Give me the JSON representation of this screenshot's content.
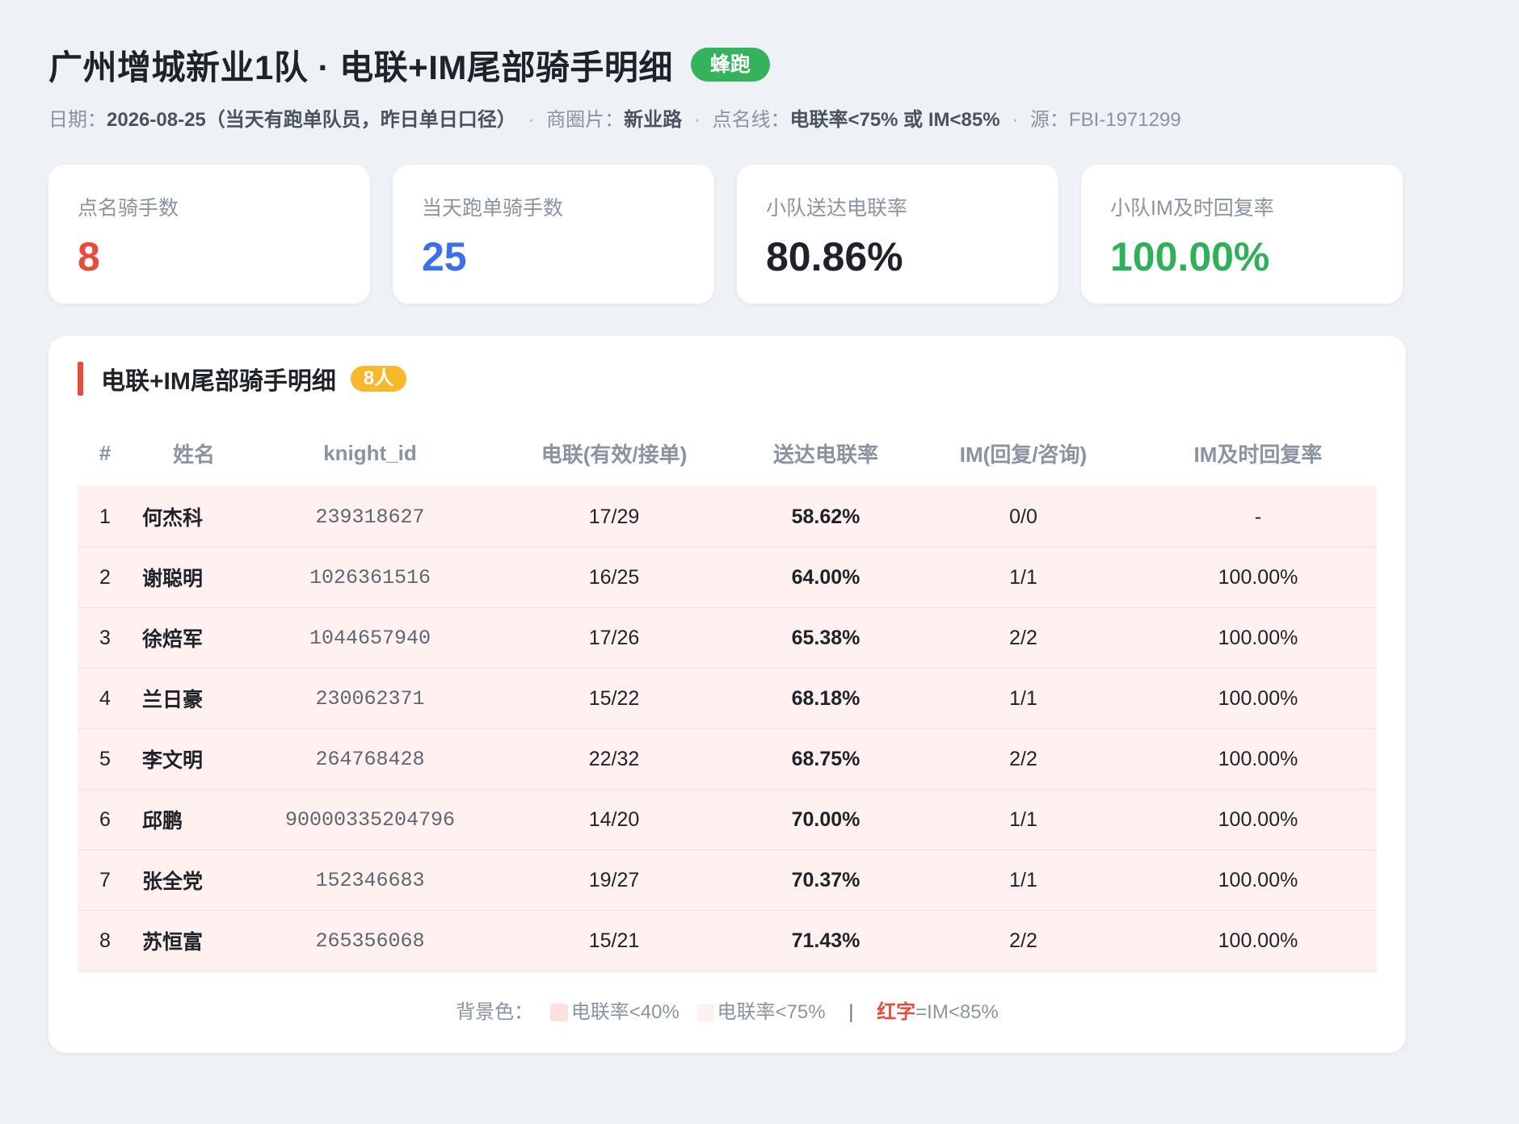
{
  "header": {
    "title": "广州增城新业1队 · 电联+IM尾部骑手明细",
    "badge": "蜂跑",
    "meta": {
      "date_label": "日期：",
      "date_value": "2026-08-25（当天有跑单队员，昨日单日口径）",
      "sep1": "·",
      "area_label": "商圈片：",
      "area_value": "新业路",
      "sep2": "·",
      "line_label": "点名线：",
      "line_value": "电联率<75% 或 IM<85%",
      "sep3": "·",
      "source": "源：FBI-1971299"
    }
  },
  "stats": [
    {
      "label": "点名骑手数",
      "value": "8",
      "color": "#e64b3c"
    },
    {
      "label": "当天跑单骑手数",
      "value": "25",
      "color": "#3a6ff0"
    },
    {
      "label": "小队送达电联率",
      "value": "80.86%",
      "color": "#1f2329"
    },
    {
      "label": "小队IM及时回复率",
      "value": "100.00%",
      "color": "#30b058"
    }
  ],
  "panel": {
    "title": "电联+IM尾部骑手明细",
    "count": "8人",
    "columns": [
      "#",
      "姓名",
      "knight_id",
      "电联(有效/接单)",
      "送达电联率",
      "IM(回复/咨询)",
      "IM及时回复率"
    ],
    "rows": [
      {
        "idx": "1",
        "name": "何杰科",
        "knight_id": "239318627",
        "call": "17/29",
        "rate": "58.62%",
        "im": "0/0",
        "im_rate": "-"
      },
      {
        "idx": "2",
        "name": "谢聪明",
        "knight_id": "1026361516",
        "call": "16/25",
        "rate": "64.00%",
        "im": "1/1",
        "im_rate": "100.00%"
      },
      {
        "idx": "3",
        "name": "徐焙军",
        "knight_id": "1044657940",
        "call": "17/26",
        "rate": "65.38%",
        "im": "2/2",
        "im_rate": "100.00%"
      },
      {
        "idx": "4",
        "name": "兰日豪",
        "knight_id": "230062371",
        "call": "15/22",
        "rate": "68.18%",
        "im": "1/1",
        "im_rate": "100.00%"
      },
      {
        "idx": "5",
        "name": "李文明",
        "knight_id": "264768428",
        "call": "22/32",
        "rate": "68.75%",
        "im": "2/2",
        "im_rate": "100.00%"
      },
      {
        "idx": "6",
        "name": "邱鹏",
        "knight_id": "90000335204796",
        "call": "14/20",
        "rate": "70.00%",
        "im": "1/1",
        "im_rate": "100.00%"
      },
      {
        "idx": "7",
        "name": "张全党",
        "knight_id": "152346683",
        "call": "19/27",
        "rate": "70.37%",
        "im": "1/1",
        "im_rate": "100.00%"
      },
      {
        "idx": "8",
        "name": "苏恒富",
        "knight_id": "265356068",
        "call": "15/21",
        "rate": "71.43%",
        "im": "2/2",
        "im_rate": "100.00%"
      }
    ],
    "legend": {
      "label": "背景色：",
      "item1": "电联率<40%",
      "item1_color": "#fde0dc",
      "item2": "电联率<75%",
      "item2_color": "#fff1ef",
      "sep": "|",
      "red_text": "红字",
      "red_rest": "=IM<85%"
    }
  }
}
